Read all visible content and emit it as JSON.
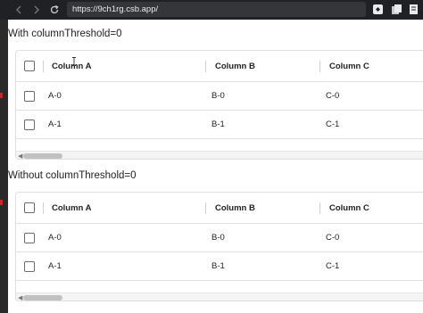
{
  "browser": {
    "url": "https://9ch1rg.csb.app/",
    "back_icon": "arrow-left-icon",
    "forward_icon": "arrow-right-icon",
    "reload_icon": "reload-icon"
  },
  "grids": [
    {
      "heading": "With columnThreshold=0",
      "columns": [
        "Column A",
        "Column B",
        "Column C"
      ],
      "rows": [
        [
          "A-0",
          "B-0",
          "C-0"
        ],
        [
          "A-1",
          "B-1",
          "C-1"
        ]
      ]
    },
    {
      "heading": "Without columnThreshold=0",
      "columns": [
        "Column A",
        "Column B",
        "Column C"
      ],
      "rows": [
        [
          "A-0",
          "B-0",
          "C-0"
        ],
        [
          "A-1",
          "B-1",
          "C-1"
        ]
      ]
    }
  ],
  "colors": {
    "chrome": "#202124",
    "border": "#e0e0e0",
    "accent_mark": "#c62828"
  }
}
